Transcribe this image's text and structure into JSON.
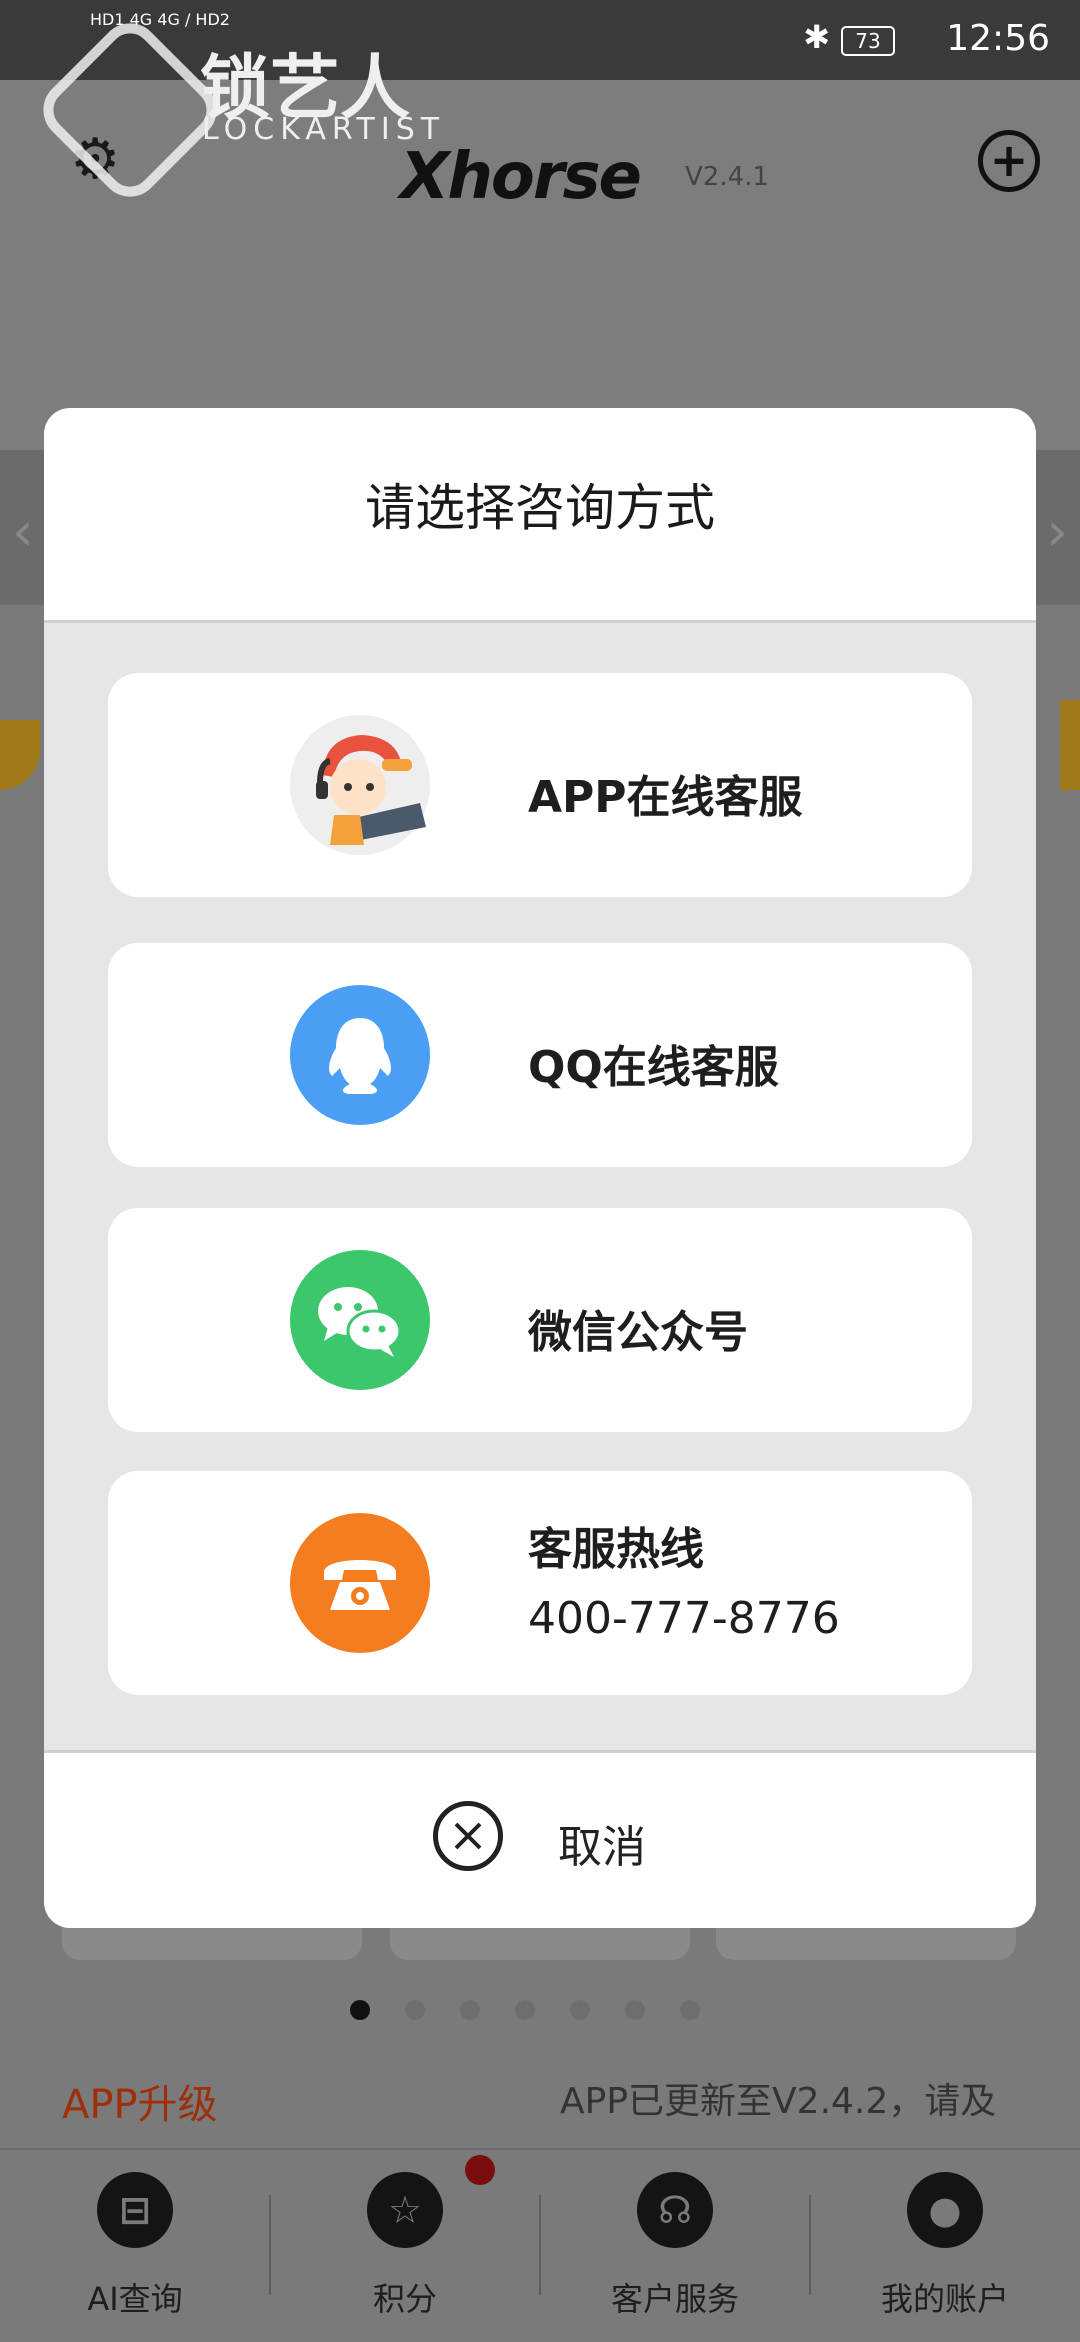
{
  "status_bar": {
    "time": "12:56",
    "battery": "73",
    "network": "HD1 4G  4G / HD2"
  },
  "watermark": {
    "cn": "锁艺人",
    "en": "LOCKARTIST"
  },
  "header": {
    "logo": "Xhorse",
    "version": "V2.4.1",
    "settings_icon": "gear-icon",
    "add_icon": "plus-circle-icon"
  },
  "dialog": {
    "title": "请选择咨询方式",
    "options": [
      {
        "label": "APP在线客服",
        "icon": "support-avatar-icon"
      },
      {
        "label": "QQ在线客服",
        "icon": "qq-penguin-icon",
        "color": "#4a9ff5"
      },
      {
        "label": "微信公众号",
        "icon": "wechat-icon",
        "color": "#3cc76c"
      },
      {
        "label": "客服热线",
        "sub": "400-777-8776",
        "icon": "phone-icon",
        "color": "#f57c1f"
      }
    ],
    "cancel_label": "取消"
  },
  "announcement": {
    "tag": "APP升级",
    "message": "APP已更新至V2.4.2，请及"
  },
  "tabs": [
    {
      "label": "AI查询",
      "icon": "ai-query-icon"
    },
    {
      "label": "积分",
      "icon": "star-icon"
    },
    {
      "label": "客户服务",
      "icon": "headset-icon"
    },
    {
      "label": "我的账户",
      "icon": "user-icon"
    }
  ],
  "carousel": {
    "count": 7,
    "active_index": 0
  }
}
